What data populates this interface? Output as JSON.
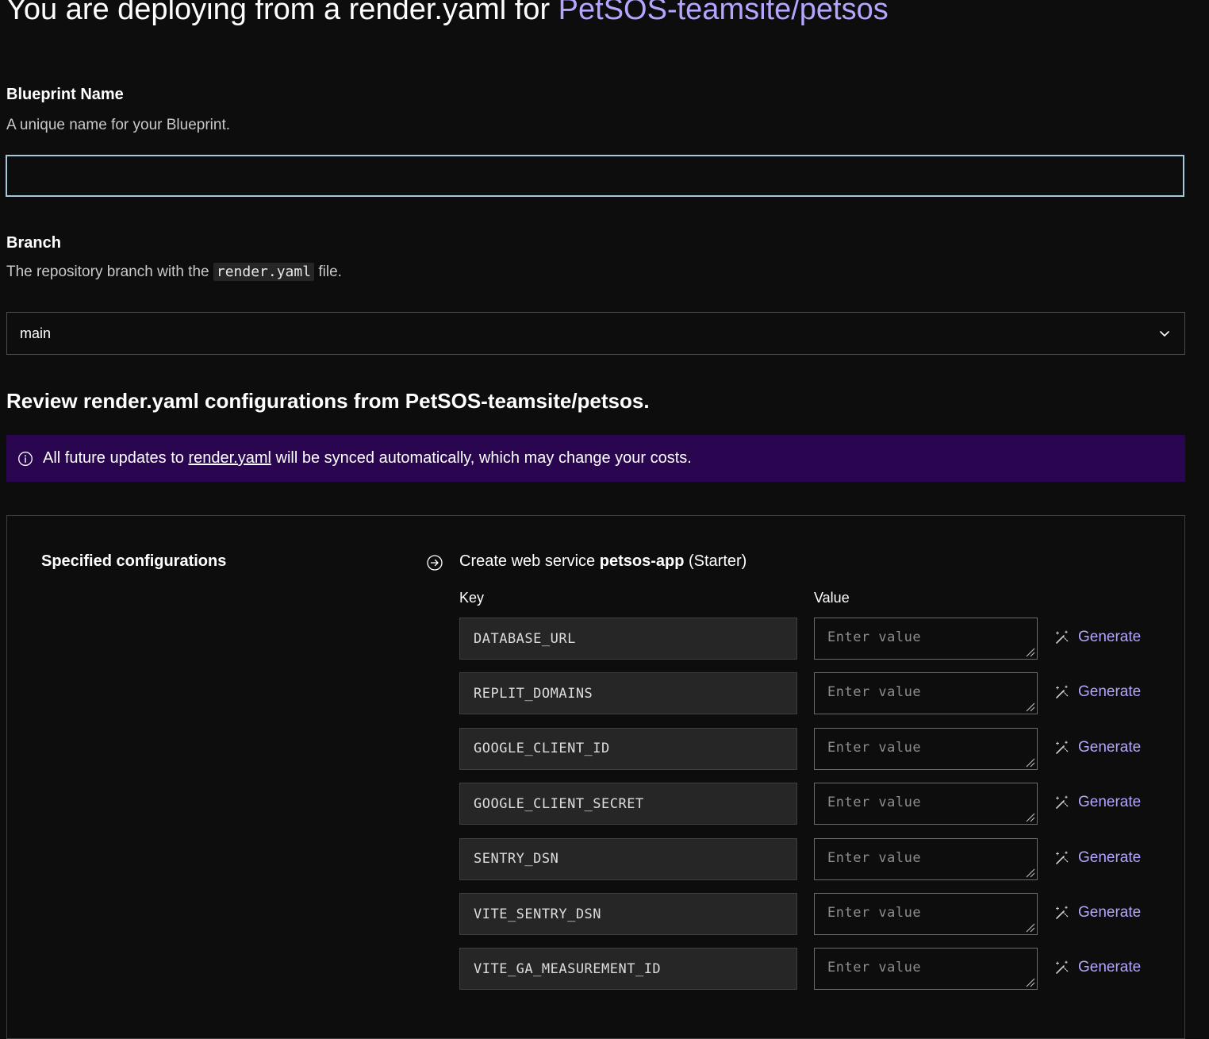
{
  "header": {
    "title_prefix": "You are deploying from a render.yaml for",
    "repo": "PetSOS-teamsite/petsos"
  },
  "blueprint": {
    "label": "Blueprint Name",
    "help": "A unique name for your Blueprint.",
    "value": ""
  },
  "branch": {
    "label": "Branch",
    "help_prefix": "The repository branch with the",
    "help_code": "render.yaml",
    "help_suffix": "file.",
    "selected": "main"
  },
  "review": {
    "title": "Review render.yaml configurations from PetSOS-teamsite/petsos."
  },
  "banner": {
    "prefix": "All future updates to",
    "link": "render.yaml",
    "suffix": "will be synced automatically, which may change your costs."
  },
  "config": {
    "section_label": "Specified configurations",
    "service_prefix": "Create web service",
    "service_name": "petsos-app",
    "service_plan": "(Starter)",
    "key_header": "Key",
    "value_header": "Value",
    "value_placeholder": "Enter value",
    "generate_label": "Generate",
    "rows": [
      {
        "key": "DATABASE_URL"
      },
      {
        "key": "REPLIT_DOMAINS"
      },
      {
        "key": "GOOGLE_CLIENT_ID"
      },
      {
        "key": "GOOGLE_CLIENT_SECRET"
      },
      {
        "key": "SENTRY_DSN"
      },
      {
        "key": "VITE_SENTRY_DSN"
      },
      {
        "key": "VITE_GA_MEASUREMENT_ID"
      }
    ]
  },
  "colors": {
    "background": "#0d0d0d",
    "accent": "#b4a5ff",
    "banner": "#2a0650",
    "focus_border": "#a6c8db"
  },
  "icons": {
    "select": "chevron-down-icon",
    "banner": "info-circle-icon",
    "service": "arrow-right-circle-icon",
    "generate": "magic-wand-icon"
  }
}
